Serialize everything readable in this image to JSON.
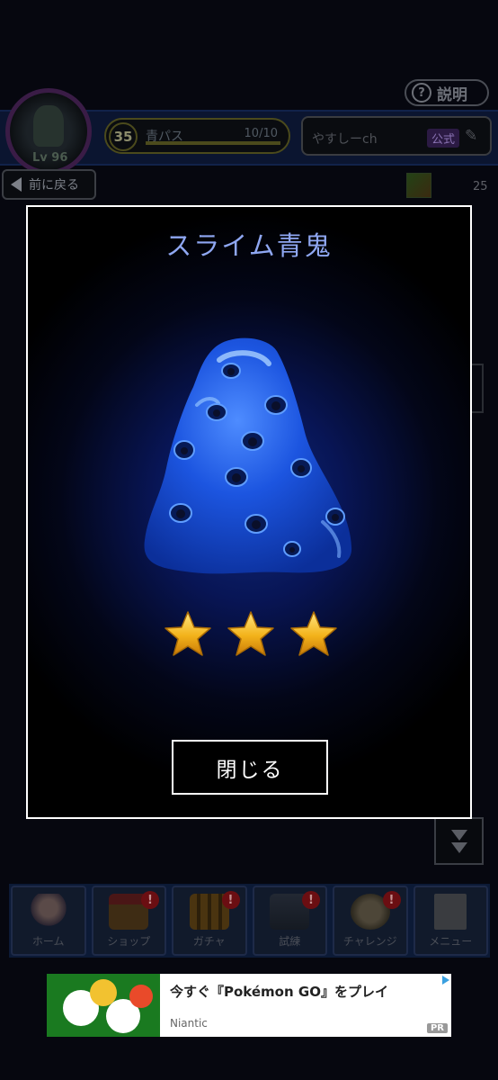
{
  "header": {
    "help_label": "説明",
    "level_label": "Lv 96",
    "pass": {
      "level": "35",
      "label": "青パス",
      "progress_text": "10/10",
      "progress": 1.0
    },
    "player_name": "やすしーch",
    "official_badge": "公式",
    "back_label": "前に戻る",
    "item_count": "25"
  },
  "modal": {
    "title": "スライム青鬼",
    "rarity_stars": 3,
    "close_label": "閉じる"
  },
  "bottom_nav": {
    "items": [
      {
        "label": "ホーム",
        "icon": "home-avatar-icon",
        "badge": ""
      },
      {
        "label": "ショップ",
        "icon": "shop-icon",
        "badge": "!"
      },
      {
        "label": "ガチャ",
        "icon": "gacha-icon",
        "badge": "!"
      },
      {
        "label": "試練",
        "icon": "castle-icon",
        "badge": "!"
      },
      {
        "label": "チャレンジ",
        "icon": "coin-icon",
        "badge": "!"
      },
      {
        "label": "メニュー",
        "icon": "document-icon",
        "badge": ""
      }
    ]
  },
  "ad": {
    "title": "今すぐ『Pokémon GO』をプレイ",
    "advertiser": "Niantic",
    "pr_label": "PR"
  },
  "colors": {
    "modal_title": "#8fa7f2",
    "monster_blue": "#1c55e0",
    "star_gold": "#f3b21a"
  }
}
